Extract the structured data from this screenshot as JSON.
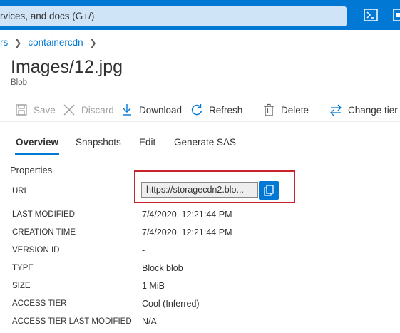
{
  "topbar": {
    "search_text": "rvices, and docs (G+/)",
    "icons": [
      "cloud-shell-icon",
      "directory-filter-icon"
    ]
  },
  "breadcrumb": {
    "items": [
      "rs",
      "containercdn"
    ]
  },
  "header": {
    "title": "Images/12.jpg",
    "subtitle": "Blob"
  },
  "toolbar": {
    "save": "Save",
    "discard": "Discard",
    "download": "Download",
    "refresh": "Refresh",
    "delete": "Delete",
    "change_tier": "Change tier"
  },
  "tabs": [
    "Overview",
    "Snapshots",
    "Edit",
    "Generate SAS"
  ],
  "active_tab": "Overview",
  "properties": {
    "section_label": "Properties",
    "url_label": "URL",
    "url_value": "https://storagecdn2.blo...",
    "rows": [
      {
        "key": "LAST MODIFIED",
        "value": "7/4/2020, 12:21:44 PM"
      },
      {
        "key": "CREATION TIME",
        "value": "7/4/2020, 12:21:44 PM"
      },
      {
        "key": "VERSION ID",
        "value": "-"
      },
      {
        "key": "TYPE",
        "value": "Block blob"
      },
      {
        "key": "SIZE",
        "value": "1 MiB"
      },
      {
        "key": "ACCESS TIER",
        "value": "Cool (Inferred)"
      },
      {
        "key": "ACCESS TIER LAST MODIFIED",
        "value": "N/A"
      }
    ]
  },
  "colors": {
    "accent": "#0078d4",
    "highlight_border": "#c8222b"
  }
}
